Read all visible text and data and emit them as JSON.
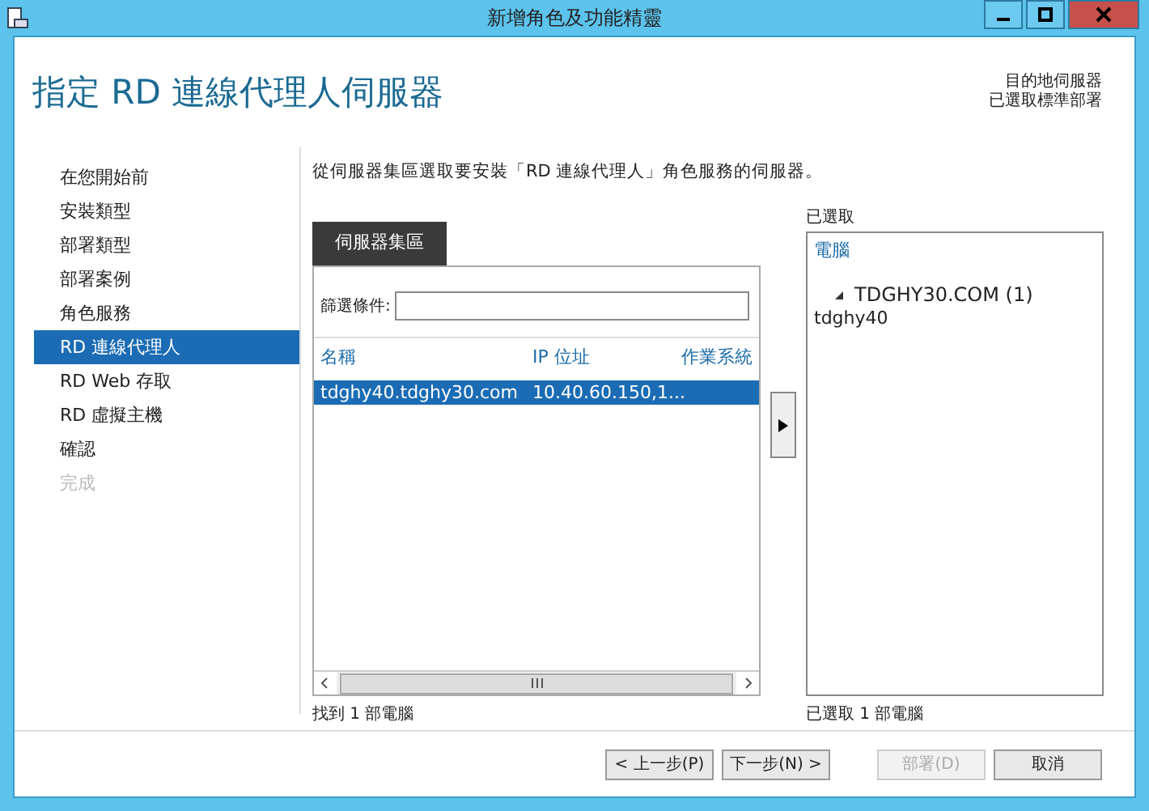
{
  "window": {
    "title": "新增角色及功能精靈"
  },
  "page_title": "指定 RD 連線代理人伺服器",
  "destination": [
    "目的地伺服器",
    "已選取標準部署"
  ],
  "steps": [
    {
      "label": "在您開始前",
      "selected": false,
      "disabled": false
    },
    {
      "label": "安裝類型",
      "selected": false,
      "disabled": false
    },
    {
      "label": "部署類型",
      "selected": false,
      "disabled": false
    },
    {
      "label": "部署案例",
      "selected": false,
      "disabled": false
    },
    {
      "label": "角色服務",
      "selected": false,
      "disabled": false
    },
    {
      "label": "RD 連線代理人",
      "selected": true,
      "disabled": false
    },
    {
      "label": "RD Web 存取",
      "selected": false,
      "disabled": false
    },
    {
      "label": "RD 虛擬主機",
      "selected": false,
      "disabled": false
    },
    {
      "label": "確認",
      "selected": false,
      "disabled": false
    },
    {
      "label": "完成",
      "selected": false,
      "disabled": true
    }
  ],
  "description": "從伺服器集區選取要安裝「RD 連線代理人」角色服務的伺服器。",
  "server_pool": {
    "tab": "伺服器集區",
    "filter_label": "篩選條件:",
    "columns": [
      "名稱",
      "IP 位址",
      "作業系統"
    ],
    "rows": [
      {
        "cells": [
          "tdghy40.tdghy30.com",
          "10.40.60.150,1..."
        ],
        "selected": true
      }
    ],
    "status": "找到 1 部電腦"
  },
  "selected_panel": {
    "label": "已選取",
    "column": "電腦",
    "tree": [
      {
        "label": "TDGHY30.COM (1)",
        "expanded": true,
        "children": [
          {
            "label": "tdghy40"
          }
        ]
      }
    ],
    "status": "已選取 1 部電腦"
  },
  "buttons": [
    {
      "label": "< 上一步(P)",
      "disabled": false
    },
    {
      "label": "下一步(N) >",
      "disabled": false
    },
    {
      "label": "部署(D)",
      "disabled": true
    },
    {
      "label": "取消",
      "disabled": false
    }
  ]
}
